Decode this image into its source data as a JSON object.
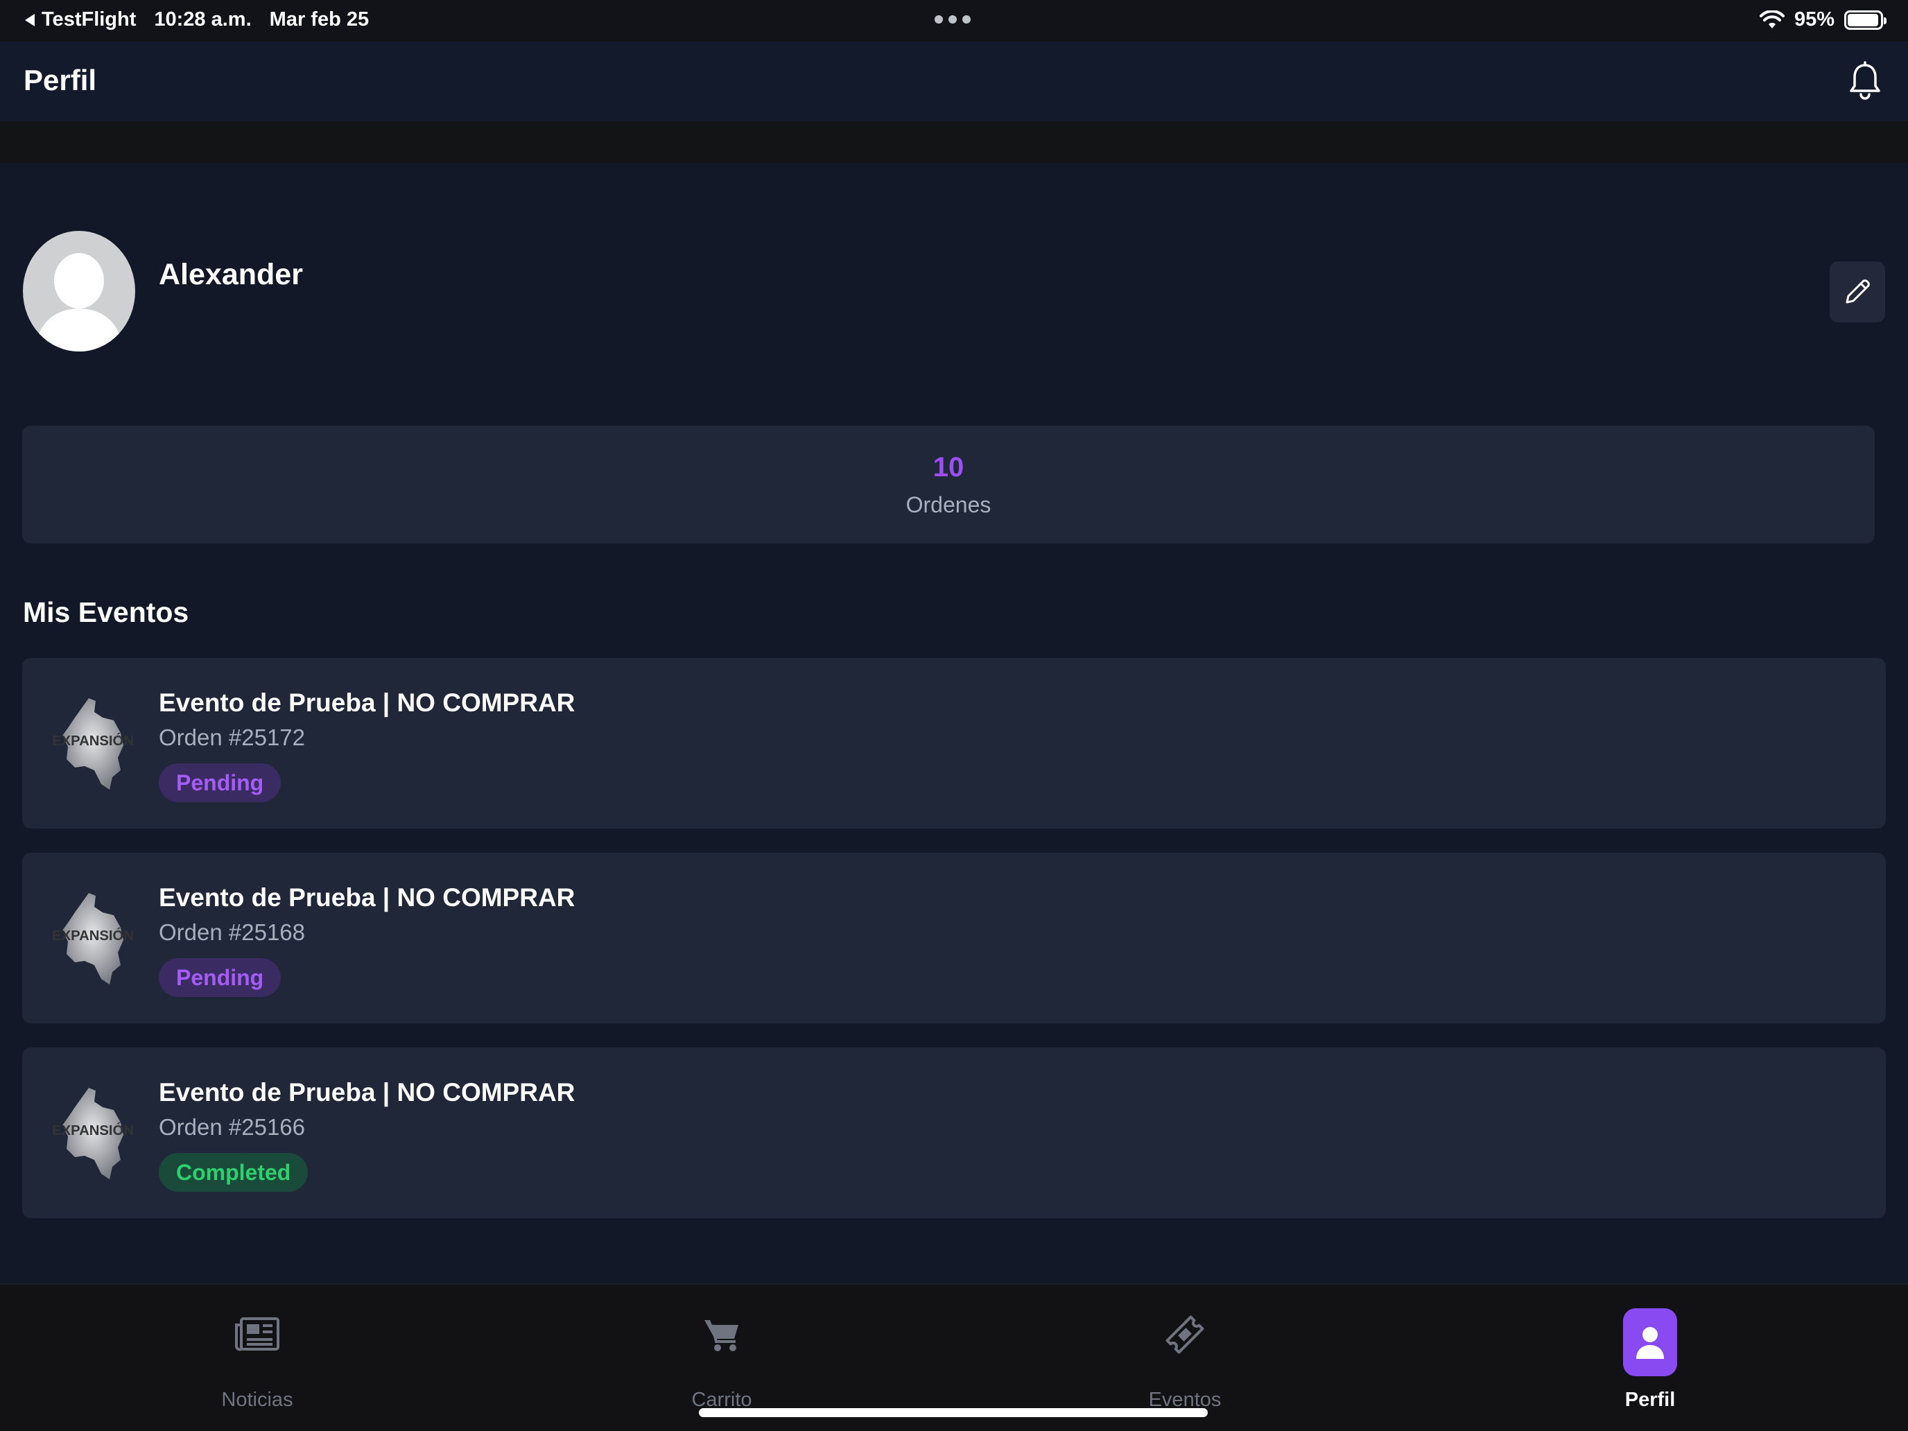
{
  "status_bar": {
    "back_app": "TestFlight",
    "time": "10:28 a.m.",
    "date": "Mar feb 25",
    "battery": "95%",
    "battery_level": 0.95
  },
  "header": {
    "title": "Perfil",
    "bell_icon": "bell-icon"
  },
  "profile": {
    "name": "Alexander",
    "avatar_icon": "user-silhouette-icon",
    "edit_icon": "pencil-icon"
  },
  "stats": {
    "value": "10",
    "label": "Ordenes"
  },
  "events_section": {
    "title": "Mis Eventos",
    "items": [
      {
        "title": "Evento de Prueba | NO COMPRAR",
        "order": "Orden #25172",
        "status": "Pending",
        "thumb_text": "EXPANSIÓN"
      },
      {
        "title": "Evento de Prueba | NO COMPRAR",
        "order": "Orden #25168",
        "status": "Pending",
        "thumb_text": "EXPANSIÓN"
      },
      {
        "title": "Evento de Prueba | NO COMPRAR",
        "order": "Orden #25166",
        "status": "Completed",
        "thumb_text": "EXPANSIÓN"
      }
    ]
  },
  "bottom_nav": {
    "items": [
      {
        "label": "Noticias",
        "icon": "newspaper-icon",
        "active": false
      },
      {
        "label": "Carrito",
        "icon": "cart-icon",
        "active": false
      },
      {
        "label": "Eventos",
        "icon": "ticket-icon",
        "active": false
      },
      {
        "label": "Perfil",
        "icon": "user-icon",
        "active": true
      }
    ]
  },
  "colors": {
    "accent": "#8a4af2",
    "pending_text": "#a55cf5",
    "completed_text": "#2ed06e",
    "card_bg": "#1f2738",
    "page_bg": "#121828"
  }
}
